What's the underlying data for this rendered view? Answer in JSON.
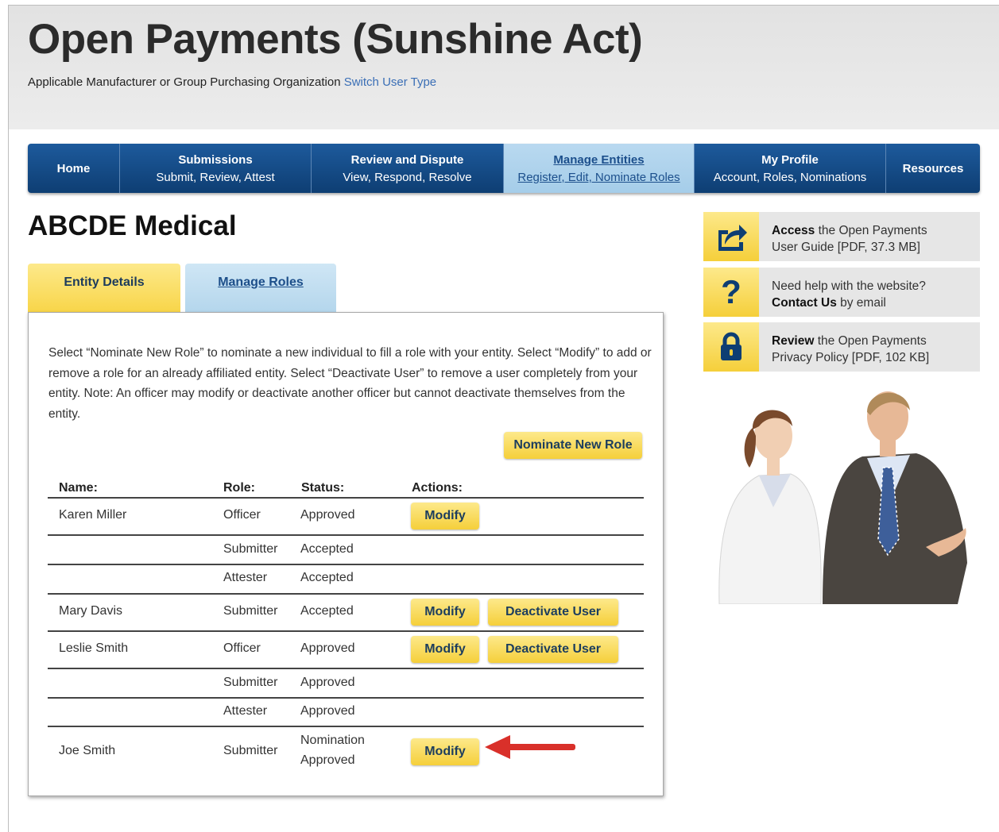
{
  "header": {
    "site_title": "Open Payments (Sunshine Act)",
    "user_type": "Applicable Manufacturer or Group Purchasing Organization",
    "switch_link": "Switch User Type"
  },
  "nav": {
    "items": [
      {
        "label": "Home",
        "sub": ""
      },
      {
        "label": "Submissions",
        "sub": "Submit, Review, Attest"
      },
      {
        "label": "Review and Dispute",
        "sub": "View, Respond, Resolve"
      },
      {
        "label": "Manage Entities",
        "sub": "Register, Edit, Nominate Roles"
      },
      {
        "label": "My Profile",
        "sub": "Account, Roles, Nominations"
      },
      {
        "label": "Resources",
        "sub": ""
      }
    ]
  },
  "entity_name": "ABCDE Medical",
  "tabs": {
    "entity_details": "Entity Details",
    "manage_roles": "Manage Roles"
  },
  "panel": {
    "intro": "Select “Nominate New Role” to nominate a new individual to fill a role with your entity. Select “Modify” to add or remove a role for an already affiliated entity. Select “Deactivate User” to remove a user completely from your entity. Note: An officer may modify or deactivate another officer but cannot deactivate themselves from the entity.",
    "nominate_button": "Nominate New Role",
    "columns": {
      "name": "Name:",
      "role": "Role:",
      "status": "Status:",
      "actions": "Actions:"
    },
    "rows": [
      {
        "name": "Karen Miller",
        "role": "Officer",
        "status": "Approved",
        "modify": "Modify"
      },
      {
        "role": "Submitter",
        "status": "Accepted"
      },
      {
        "role": "Attester",
        "status": "Accepted"
      },
      {
        "name": "Mary Davis",
        "role": "Submitter",
        "status": "Accepted",
        "modify": "Modify",
        "deactivate": "Deactivate User"
      },
      {
        "name": "Leslie Smith",
        "role": "Officer",
        "status": "Approved",
        "modify": "Modify",
        "deactivate": "Deactivate User"
      },
      {
        "role": "Submitter",
        "status": "Approved"
      },
      {
        "role": "Attester",
        "status": "Approved"
      },
      {
        "name": "Joe Smith",
        "role": "Submitter",
        "status_line1": "Nomination",
        "status_line2": "Approved",
        "modify": "Modify"
      }
    ]
  },
  "sidebar": {
    "guide": {
      "bold": "Access",
      "text1": " the Open Payments",
      "text2": "User Guide [PDF, 37.3 MB]",
      "icon": "share-icon"
    },
    "help": {
      "text1": "Need help with the website?",
      "bold": "Contact Us",
      "text2": " by email",
      "icon": "question-icon"
    },
    "privacy": {
      "bold": "Review",
      "text1": " the Open Payments",
      "text2": "Privacy Policy [PDF, 102 KB]",
      "icon": "lock-icon"
    }
  },
  "colors": {
    "nav_blue": "#1d5a9c",
    "active_tab_blue": "#b4d6ec",
    "button_yellow": "#f5cf3a",
    "arrow_red": "#d9302a",
    "link_blue": "#3b6fb6"
  }
}
